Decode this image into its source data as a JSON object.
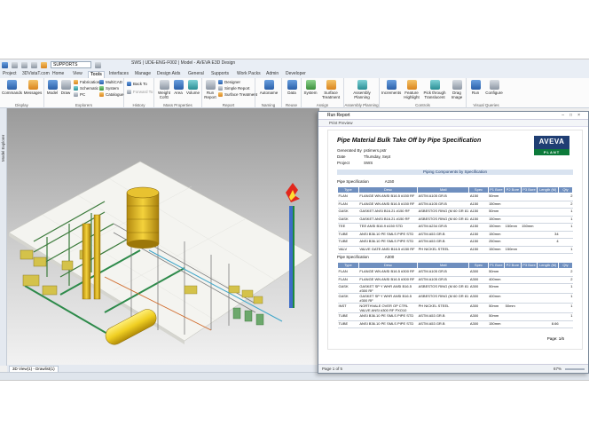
{
  "quick_access": {
    "combo": "SUPPORTS"
  },
  "window_title": "SWS | UDE-ENG-F002 | Model - AVEVA E3D Design",
  "tabs": [
    "Project",
    "3DVistaT.com",
    "Home",
    "View",
    "Tools",
    "Interfaces",
    "Manage",
    "Design Aids",
    "General",
    "Supports",
    "Work Packs",
    "Admin",
    "Developer"
  ],
  "ribbon": {
    "display": {
      "label": "Display",
      "commands": "Commands",
      "messages": "Messages"
    },
    "explorers": {
      "label": "Explorers",
      "model": "Model",
      "draw": "Draw",
      "fabrication": "Fabrication",
      "schematic": "Schematic",
      "pc": "PC",
      "multicad": "MultiCAD",
      "system": "System",
      "catalogue": "Catalogue"
    },
    "history": {
      "label": "History",
      "back": "Back To",
      "forward": "Forward To"
    },
    "mass": {
      "label": "Mass Properties",
      "weight": "Weight CofG",
      "area": "Area",
      "volume": "Volume"
    },
    "report": {
      "label": "Report",
      "run": "Run Report",
      "designer": "Designer",
      "simple": "Simple Report",
      "surface": "Surface Treatment"
    },
    "naming": {
      "label": "Naming",
      "autoname": "Autoname"
    },
    "reuse": {
      "label": "Reuse",
      "data": "Data"
    },
    "assign": {
      "label": "Assign",
      "system": "System",
      "surface": "Surface Treatment"
    },
    "assembly": {
      "label": "Assembly Planning",
      "btn": "Assembly Planning"
    },
    "controls": {
      "label": "Controls",
      "increments": "Increments",
      "feature": "Feature Highlight",
      "pick": "Pick through Translucent",
      "drag": "Drag Image"
    },
    "visual": {
      "label": "Visual Queries",
      "run": "Run",
      "configure": "Configure"
    }
  },
  "left_bar_label": "Model Explorer",
  "viewport_tab": "3D View(1) - Drawlist(1)",
  "report_window": {
    "title": "Run Report",
    "toolbar": "Print Preview",
    "heading": "Pipe Material Bulk Take Off by Pipe Specification",
    "meta": [
      {
        "k": "Generated By",
        "v": "pstimers.pstr"
      },
      {
        "k": "Date",
        "v": "Thursday, Sept"
      },
      {
        "k": "Project",
        "v": "SWS"
      }
    ],
    "logo": "AVEVA",
    "logo_sub": "PLANT",
    "section_title": "Piping Components by Specification",
    "columns": [
      "Type",
      "Desc",
      "Matl",
      "Spec",
      "P1 Bore",
      "P2 Bore",
      "P3 Bore",
      "Length (M)",
      "Qty"
    ],
    "spec1": {
      "label": "Pipe Specification",
      "value": "A150"
    },
    "rows1": [
      [
        "FLAN",
        "FLANGE WN ANSI B16.5 #150 RF",
        "ASTM A105 GR.B",
        "A150",
        "50mm",
        "",
        "",
        "",
        "2"
      ],
      [
        "FLAN",
        "FLANGE WN ANSI B16.5 #150 RF",
        "ASTM A105 GR.B",
        "A150",
        "150mm",
        "",
        "",
        "",
        "2"
      ],
      [
        "GASK",
        "GASKET ANSI B16.21 #150 RF",
        "ASBESTOS RING (M 60 GR 81",
        "A150",
        "50mm",
        "",
        "",
        "",
        "1"
      ],
      [
        "GASK",
        "GASKET ANSI B16.21 #150 RF",
        "ASBESTOS RING (M 60 GR 81",
        "A150",
        "150mm",
        "",
        "",
        "",
        "1"
      ],
      [
        "TEE",
        "TEE ANSI B16.9 #150 STD",
        "ASTM A234 GR.B",
        "A150",
        "150mm",
        "150mm",
        "150mm",
        "",
        "1"
      ],
      [
        "TUBE",
        "ANSI B36.10 PE SMLS PIPE STD",
        "ASTM A53 GR.B",
        "A150",
        "150mm",
        "",
        "",
        "34",
        ""
      ],
      [
        "TUBE",
        "ANSI B36.10 PE SMLS PIPE STD",
        "ASTM A53 GR.B",
        "A150",
        "250mm",
        "",
        "",
        "4",
        ""
      ],
      [
        "VALV",
        "VALVE GATE ANSI B16.5 #150 RF",
        "PH NICKEL STEEL",
        "A150",
        "150mm",
        "150mm",
        "",
        "",
        "1"
      ]
    ],
    "spec2": {
      "label": "Pipe Specification",
      "value": "A300"
    },
    "rows2": [
      [
        "FLAN",
        "FLANGE WN ANSI B16.5 #300 RF",
        "ASTM A105 GR.B",
        "A300",
        "50mm",
        "",
        "",
        "",
        "2"
      ],
      [
        "FLAN",
        "FLANGE WN ANSI B16.5 #300 RF",
        "ASTM A105 GR.B",
        "A300",
        "400mm",
        "",
        "",
        "",
        "2"
      ],
      [
        "GASK",
        "GASKET SP Y WHR ANSI B16.5 #300 RF",
        "ASBESTOS RING (M 60 GR 81",
        "A300",
        "50mm",
        "",
        "",
        "",
        "1"
      ],
      [
        "GASK",
        "GASKET SP Y WHR ANSI B16.5 #300 RF",
        "ASBESTOS RING (M 60 GR 81",
        "A300",
        "400mm",
        "",
        "",
        "",
        "1"
      ],
      [
        "INST",
        "NORTHVALE OVER OP CTRL VALVE ANSI #300 RF PXO10",
        "PH NICKEL STEEL",
        "A300",
        "50mm",
        "50mm",
        "",
        "",
        "1"
      ],
      [
        "TUBE",
        "ANSI B36.10 PE SMLS PIPE STD",
        "ASTM A53 GR.B",
        "A300",
        "50mm",
        "",
        "",
        "",
        "1"
      ],
      [
        "TUBE",
        "ANSI B36.10 PE SMLS PIPE STD",
        "ASTM A53 GR.B",
        "A300",
        "150mm",
        "",
        "",
        "8.66",
        ""
      ]
    ],
    "page_label": "Page:",
    "page_value": "1/6",
    "footer": "Page 1 of 5",
    "zoom": "67%"
  }
}
